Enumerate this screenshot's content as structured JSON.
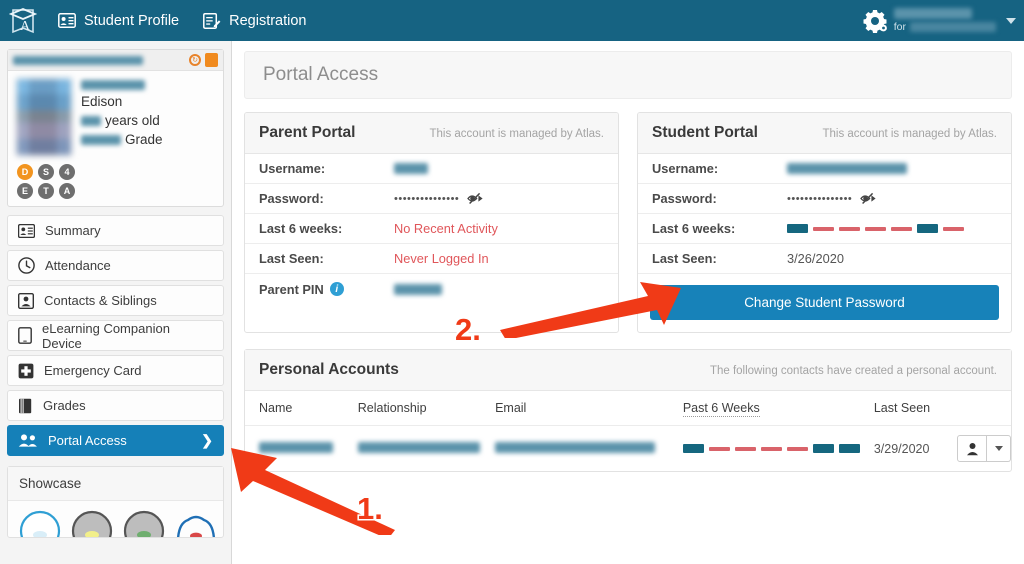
{
  "topnav": {
    "logo_icon": "graduation-cap-logo",
    "items": [
      {
        "label": "Student Profile",
        "icon": "id-card-icon"
      },
      {
        "label": "Registration",
        "icon": "form-edit-icon"
      }
    ],
    "gear_icon": "gear-icon",
    "user_for_label": "for",
    "user_name_redacted": "",
    "user_org_redacted": "",
    "caret_icon": "chevron-down-icon"
  },
  "sidebar": {
    "profile": {
      "header_name_redacted": "",
      "refresh_icon": "refresh-clock-icon",
      "flag_icon": "orange-flag-icon",
      "photo_alt": "student-photo-redacted",
      "first_name_redacted": "",
      "last_name": "Edison",
      "age_redacted": "",
      "age_label": "years old",
      "grade_redacted": "",
      "grade_label": "Grade",
      "badges": [
        {
          "label": "D",
          "color": "#f2941f"
        },
        {
          "label": "S",
          "color": "#6e6e6e"
        },
        {
          "label": "4",
          "color": "#6e6e6e"
        },
        {
          "label": "E",
          "color": "#6e6e6e"
        },
        {
          "label": "T",
          "color": "#6e6e6e"
        },
        {
          "label": "A",
          "color": "#6e6e6e"
        }
      ]
    },
    "items": [
      {
        "label": "Summary",
        "icon": "id-card-icon",
        "active": false
      },
      {
        "label": "Attendance",
        "icon": "clock-icon",
        "active": false
      },
      {
        "label": "Contacts & Siblings",
        "icon": "person-card-icon",
        "active": false
      },
      {
        "label": "eLearning Companion Device",
        "icon": "tablet-icon",
        "active": false
      },
      {
        "label": "Emergency Card",
        "icon": "medical-cross-icon",
        "active": false
      },
      {
        "label": "Grades",
        "icon": "book-icon",
        "active": false
      },
      {
        "label": "Portal Access",
        "icon": "people-icon",
        "active": true,
        "chevron": "chevron-right-icon"
      }
    ],
    "showcase": {
      "title": "Showcase",
      "gauges": [
        "gauge-blue-icon",
        "gauge-yellow-icon",
        "gauge-green-icon",
        "gauge-red-icon"
      ]
    }
  },
  "main": {
    "page_title": "Portal Access",
    "parent_portal": {
      "title": "Parent Portal",
      "subtitle": "This account is managed by Atlas.",
      "rows": {
        "username_label": "Username:",
        "username_value_redacted": "",
        "password_label": "Password:",
        "password_value": "•••••••••••••••",
        "password_toggle_icon": "eye-slash-icon",
        "last6_label": "Last 6 weeks:",
        "last6_value": "No Recent Activity",
        "lastseen_label": "Last Seen:",
        "lastseen_value": "Never Logged In",
        "pin_label": "Parent PIN",
        "pin_info_icon": "info-icon",
        "pin_value_redacted": ""
      }
    },
    "student_portal": {
      "title": "Student Portal",
      "subtitle": "This account is managed by Atlas.",
      "rows": {
        "username_label": "Username:",
        "username_value_redacted": "",
        "password_label": "Password:",
        "password_value": "•••••••••••••••",
        "password_toggle_icon": "eye-slash-icon",
        "last6_label": "Last 6 weeks:",
        "last6_marks": [
          1,
          0,
          0,
          0,
          0,
          1,
          0
        ],
        "lastseen_label": "Last Seen:",
        "lastseen_value": "3/26/2020"
      },
      "change_password_button": "Change Student Password"
    },
    "personal_accounts": {
      "title": "Personal Accounts",
      "subtitle": "The following contacts have created a personal account.",
      "columns": [
        "Name",
        "Relationship",
        "Email",
        "Past 6 Weeks",
        "Last Seen"
      ],
      "rows": [
        {
          "name_redacted": "",
          "relationship_redacted": "",
          "email_redacted": "",
          "past6_marks": [
            1,
            0,
            0,
            0,
            0,
            1,
            1
          ],
          "last_seen": "3/29/2020",
          "action_icon": "person-icon",
          "action_caret_icon": "chevron-down-icon"
        }
      ]
    }
  },
  "annotations": [
    {
      "number": "1.",
      "target": "sidebar-item-portal-access"
    },
    {
      "number": "2.",
      "target": "change-student-password-button"
    }
  ],
  "colors": {
    "topnav": "#166382",
    "accent_blue": "#1580b8",
    "alert_red": "#e0565a",
    "badge_orange": "#f2941f",
    "activity_on": "#15677f",
    "activity_off": "#d9636a",
    "annotation_red": "#f03a17"
  }
}
